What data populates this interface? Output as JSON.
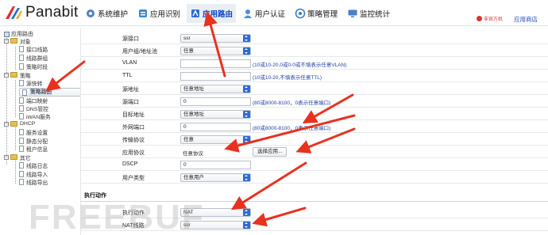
{
  "app": {
    "logo_text": "Panabit",
    "official_badge": "非官方机",
    "store_link": "应用商店"
  },
  "nav": [
    {
      "label": "系统维护",
      "icon": "gear-icon"
    },
    {
      "label": "应用识别",
      "icon": "app-recognition-icon"
    },
    {
      "label": "应用路由",
      "icon": "route-icon",
      "active": true
    },
    {
      "label": "用户认证",
      "icon": "user-icon"
    },
    {
      "label": "策略管理",
      "icon": "settings-icon"
    },
    {
      "label": "监控统计",
      "icon": "monitor-icon"
    }
  ],
  "sidebar": {
    "root": "应用路由",
    "groups": [
      {
        "label": "对象",
        "items": [
          "接口线路",
          "线路群组",
          "策略时段"
        ]
      },
      {
        "label": "策略",
        "items": [
          "源快转",
          "策略路由",
          "端口映射",
          "DNS管控",
          "iWAN服务"
        ]
      },
      {
        "label": "DHCP",
        "items": [
          "服务设置",
          "静态分配",
          "租户信息"
        ]
      },
      {
        "label": "其它",
        "items": [
          "线路日志",
          "线路导入",
          "线路导出"
        ]
      }
    ],
    "selected": "策略路由"
  },
  "form": {
    "rows": [
      {
        "label": "源接口",
        "type": "select",
        "value": "ssr"
      },
      {
        "label": "用户组/地址池",
        "type": "select",
        "value": "任意"
      },
      {
        "label": "VLAN",
        "type": "input",
        "value": "",
        "hint": "(10或10-20,0或0-0或不填表示任意VLAN)"
      },
      {
        "label": "TTL",
        "type": "input",
        "value": "",
        "hint": "(10或10-20,不填表示任意TTL)"
      },
      {
        "label": "源地址",
        "type": "select",
        "value": "任意地址"
      },
      {
        "label": "源端口",
        "type": "input",
        "value": "0",
        "hint": "(80或8000-8100，0表示任意端口)"
      },
      {
        "label": "目标地址",
        "type": "select",
        "value": "任意地址"
      },
      {
        "label": "外网端口",
        "type": "input",
        "value": "0",
        "hint": "(80或8000-8100，0表示任意端口)"
      },
      {
        "label": "传输协议",
        "type": "select",
        "value": "任意"
      },
      {
        "label": "应用协议",
        "type": "text",
        "value": "任意协议",
        "button": "选择应用..."
      },
      {
        "label": "DSCP",
        "type": "input",
        "value": "0"
      },
      {
        "label": "用户类型",
        "type": "select",
        "value": "任意用户"
      }
    ],
    "section_title": "执行动作",
    "action_rows": [
      {
        "label": "执行动作",
        "type": "select",
        "value": "NAT"
      },
      {
        "label": "NAT线路",
        "type": "select",
        "value": "ssr"
      }
    ]
  },
  "watermark": "FREEBUF",
  "colors": {
    "annotation": "#e8321f",
    "link": "#1f4fb0",
    "active_nav": "#0a47c2",
    "select_arrow": "#2d6bd6"
  }
}
